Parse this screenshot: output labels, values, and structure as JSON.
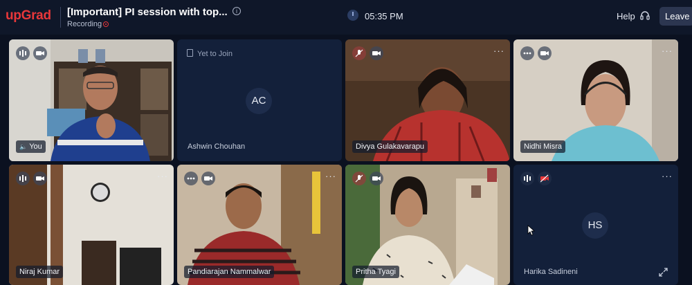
{
  "header": {
    "logo": "upGrad",
    "title": "[Important] PI session with top...",
    "recording_label": "Recording",
    "time": "05:35 PM",
    "help_label": "Help",
    "leave_label": "Leave"
  },
  "colors": {
    "brand": "#e8373a",
    "background": "#0d1424",
    "tile_dark": "#13203a"
  },
  "participants": [
    {
      "name": "You",
      "status": "speaking"
    },
    {
      "name": "Ashwin Chouhan",
      "status": "Yet to Join",
      "initials": "AC"
    },
    {
      "name": "Divya Gulakavarapu"
    },
    {
      "name": "Nidhi Misra"
    },
    {
      "name": "Niraj Kumar"
    },
    {
      "name": "Pandiarajan Nammalwar"
    },
    {
      "name": "Pritha Tyagi"
    },
    {
      "name": "Harika Sadineni",
      "initials": "HS",
      "video": "off"
    }
  ]
}
